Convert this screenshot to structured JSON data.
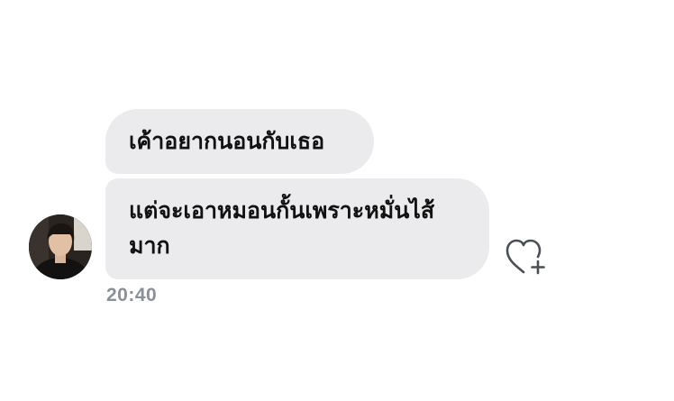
{
  "chat": {
    "messages": [
      {
        "text": "เค้าอยากนอนกับเธอ"
      },
      {
        "text": "แต่จะเอาหมอนกั้นเพราะหมั่นไส้มาก"
      }
    ],
    "timestamp": "20:40",
    "avatar_icon": "user-avatar-photo",
    "react_icon": "heart-plus-icon"
  },
  "colors": {
    "bubble_background": "#ebebed",
    "message_text": "#111111",
    "timestamp_text": "#8a8f98",
    "icon_stroke": "#4a4f57"
  }
}
